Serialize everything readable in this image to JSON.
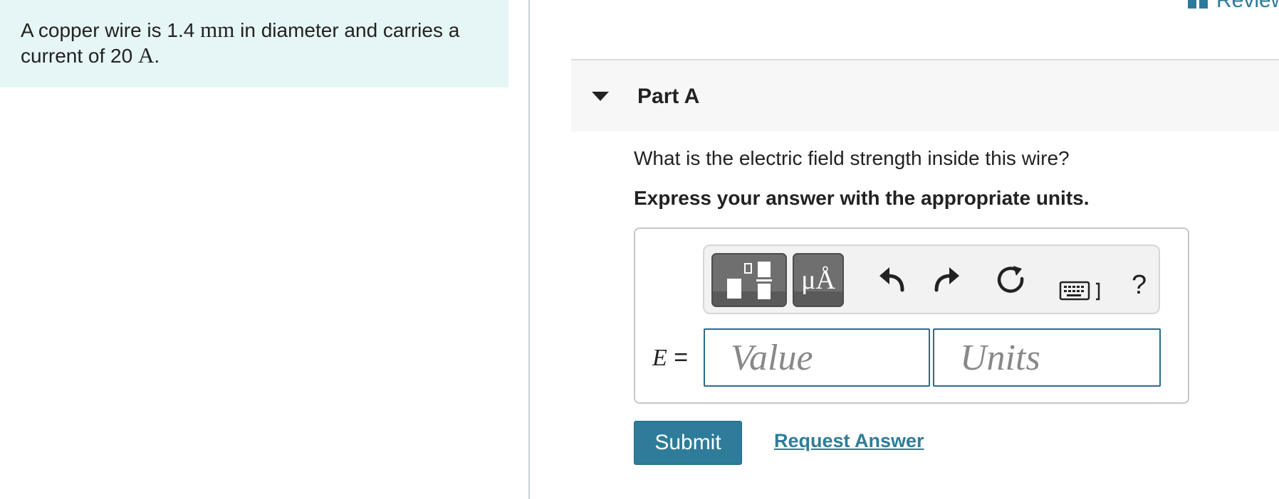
{
  "problem": {
    "line1_prefix": "A copper wire is 1.4",
    "line1_unit": "mm",
    "line1_suffix": "in diameter and carries a",
    "line2_prefix": "current of 20",
    "line2_unit": "A",
    "line2_suffix": "."
  },
  "review": {
    "label": "Review"
  },
  "part": {
    "title": "Part A"
  },
  "question": "What is the electric field strength inside this wire?",
  "instruction": "Express your answer with the appropriate units.",
  "toolbar": {
    "units_glyph": "μÅ",
    "help": "?"
  },
  "answer": {
    "variable": "E",
    "equals": "=",
    "value_placeholder": "Value",
    "units_placeholder": "Units"
  },
  "actions": {
    "submit": "Submit",
    "request": "Request Answer"
  },
  "colors": {
    "accent": "#2e7c99",
    "problem_bg": "#e6f5f5"
  }
}
